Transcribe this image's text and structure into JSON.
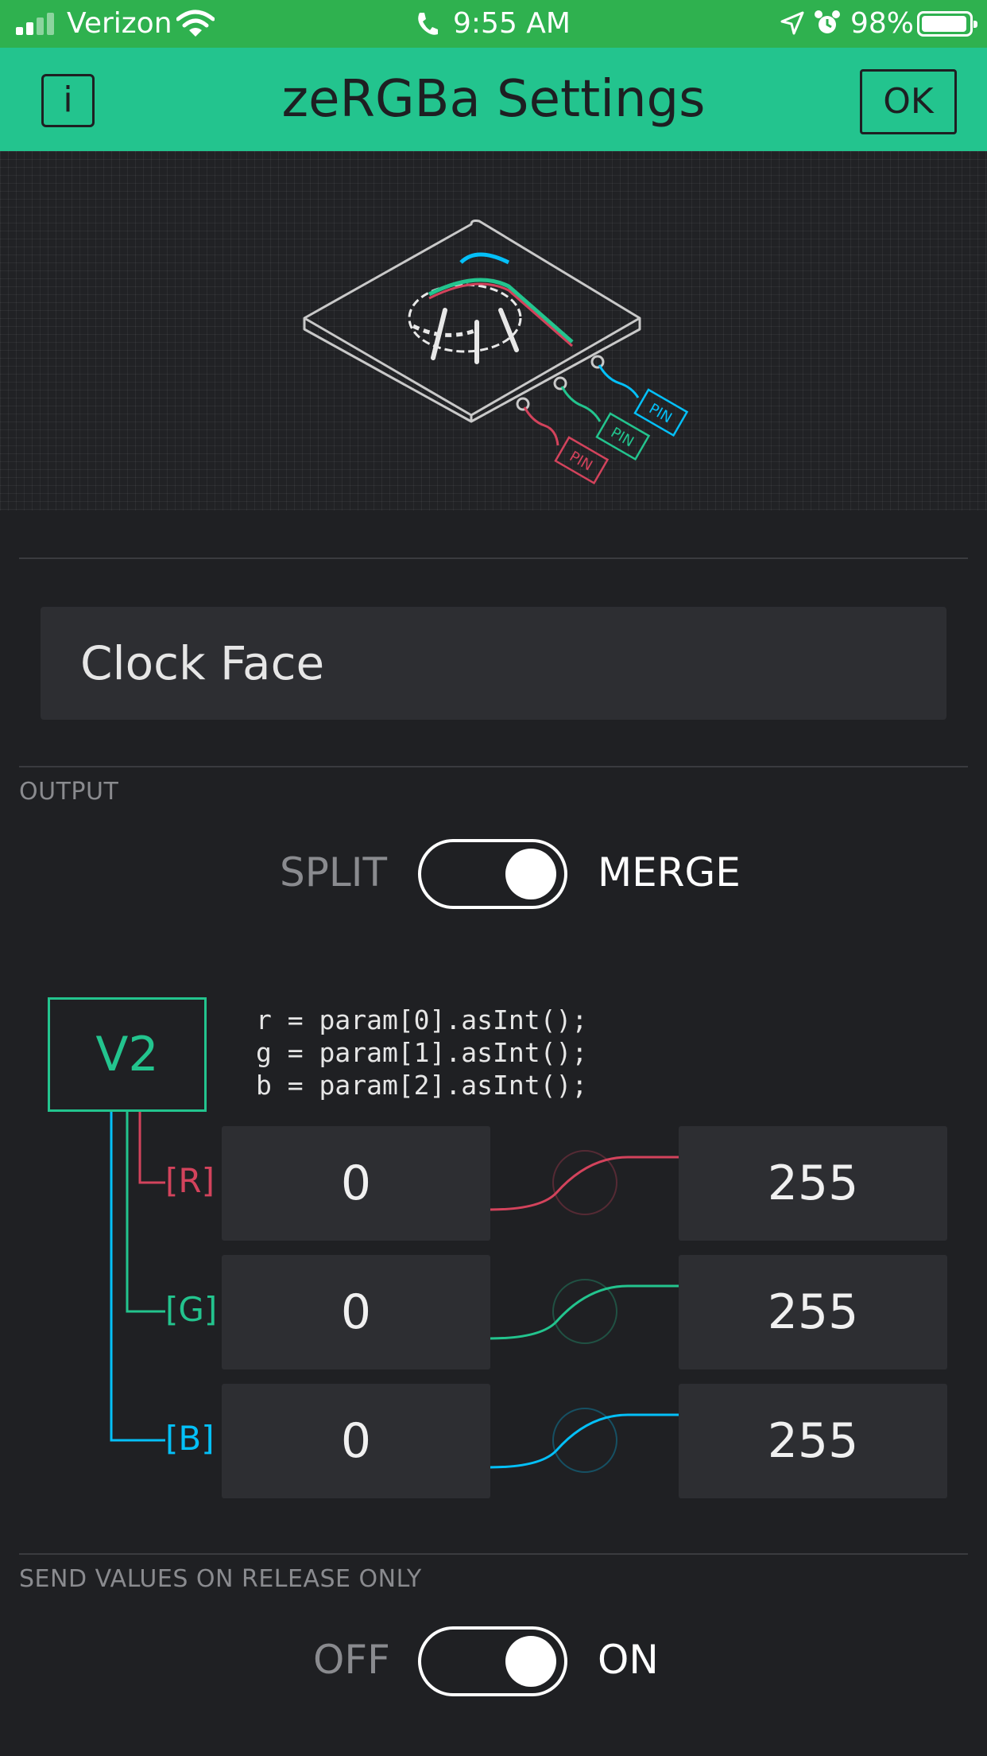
{
  "status_bar": {
    "carrier": "Verizon",
    "time": "9:55 AM",
    "battery": "98%"
  },
  "header": {
    "title": "zeRGBa Settings",
    "info_label": "i",
    "ok_label": "OK"
  },
  "illustration": {
    "pin_label": "PIN"
  },
  "widget_name": {
    "value": "Clock Face"
  },
  "output": {
    "section_label": "OUTPUT",
    "left_label": "SPLIT",
    "right_label": "MERGE",
    "merge_on": true,
    "pin": "V2",
    "code_lines": [
      "r = param[0].asInt();",
      "g = param[1].asInt();",
      "b = param[2].asInt();"
    ],
    "channels": [
      {
        "label": "[R]",
        "min": "0",
        "max": "255",
        "color": "#d3435c"
      },
      {
        "label": "[G]",
        "min": "0",
        "max": "255",
        "color": "#23c48e"
      },
      {
        "label": "[B]",
        "min": "0",
        "max": "255",
        "color": "#04c0f8"
      }
    ]
  },
  "send_on_release": {
    "section_label": "SEND VALUES ON RELEASE ONLY",
    "left_label": "OFF",
    "right_label": "ON",
    "on": true
  },
  "colors": {
    "status_bar": "#2fb14f",
    "header": "#23c48e",
    "background": "#1f2023",
    "field": "#2d2e32",
    "red": "#d3435c",
    "green": "#23c48e",
    "blue": "#04c0f8"
  }
}
